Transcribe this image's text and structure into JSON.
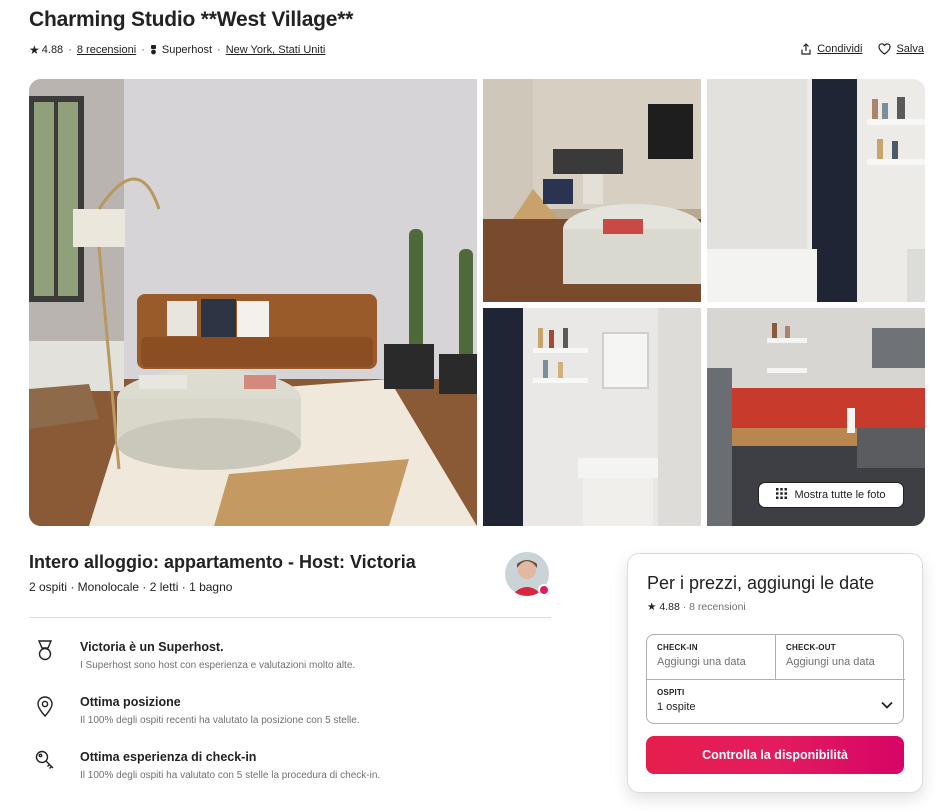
{
  "listing": {
    "title": "Charming Studio **West Village**",
    "rating": "4.88",
    "reviews_link": "8 recensioni",
    "superhost_label": "Superhost",
    "location_link": "New York, Stati Uniti",
    "share_label": "Condividi",
    "save_label": "Salva"
  },
  "gallery": {
    "show_all_label": "Mostra tutte le foto"
  },
  "details": {
    "heading": "Intero alloggio: appartamento - Host: Victoria",
    "summary": "2 ospiti · Monolocale · 2 letti · 1 bagno"
  },
  "highlights": [
    {
      "icon": "superhost-medal-icon",
      "title": "Victoria è un Superhost.",
      "description": "I Superhost sono host con esperienza e valutazioni molto alte."
    },
    {
      "icon": "location-pin-icon",
      "title": "Ottima posizione",
      "description": "Il 100% degli ospiti recenti ha valutato la posizione con 5 stelle."
    },
    {
      "icon": "key-icon",
      "title": "Ottima esperienza di check-in",
      "description": "Il 100% degli ospiti ha valutato con 5 stelle la procedura di check-in."
    }
  ],
  "booking": {
    "title": "Per i prezzi, aggiungi le date",
    "rating": "4.88",
    "reviews": "8 recensioni",
    "checkin_label": "CHECK-IN",
    "checkin_placeholder": "Aggiungi una data",
    "checkout_label": "CHECK-OUT",
    "checkout_placeholder": "Aggiungi una data",
    "guests_label": "OSPITI",
    "guests_value": "1 ospite",
    "cta_label": "Controlla la disponibilità"
  },
  "colors": {
    "brand": "#e31c5f",
    "text": "#222222",
    "muted": "#717171",
    "border": "#dddddd"
  }
}
